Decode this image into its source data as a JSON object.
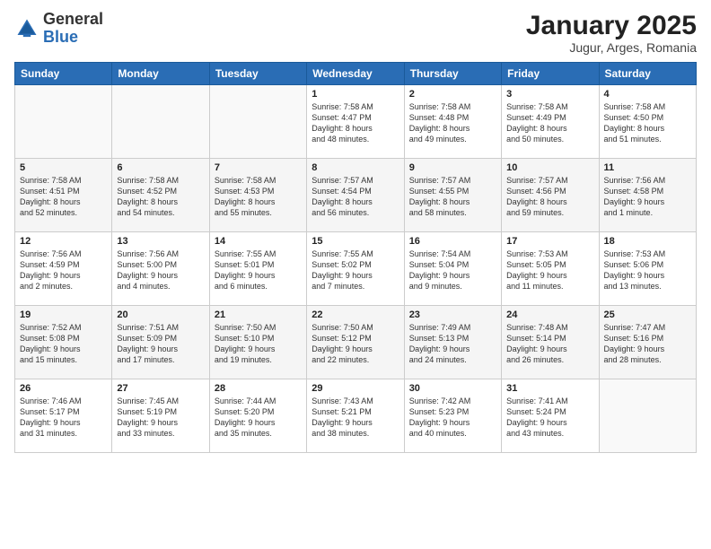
{
  "header": {
    "logo_general": "General",
    "logo_blue": "Blue",
    "month_title": "January 2025",
    "location": "Jugur, Arges, Romania"
  },
  "days_of_week": [
    "Sunday",
    "Monday",
    "Tuesday",
    "Wednesday",
    "Thursday",
    "Friday",
    "Saturday"
  ],
  "weeks": [
    [
      {
        "num": "",
        "info": ""
      },
      {
        "num": "",
        "info": ""
      },
      {
        "num": "",
        "info": ""
      },
      {
        "num": "1",
        "info": "Sunrise: 7:58 AM\nSunset: 4:47 PM\nDaylight: 8 hours\nand 48 minutes."
      },
      {
        "num": "2",
        "info": "Sunrise: 7:58 AM\nSunset: 4:48 PM\nDaylight: 8 hours\nand 49 minutes."
      },
      {
        "num": "3",
        "info": "Sunrise: 7:58 AM\nSunset: 4:49 PM\nDaylight: 8 hours\nand 50 minutes."
      },
      {
        "num": "4",
        "info": "Sunrise: 7:58 AM\nSunset: 4:50 PM\nDaylight: 8 hours\nand 51 minutes."
      }
    ],
    [
      {
        "num": "5",
        "info": "Sunrise: 7:58 AM\nSunset: 4:51 PM\nDaylight: 8 hours\nand 52 minutes."
      },
      {
        "num": "6",
        "info": "Sunrise: 7:58 AM\nSunset: 4:52 PM\nDaylight: 8 hours\nand 54 minutes."
      },
      {
        "num": "7",
        "info": "Sunrise: 7:58 AM\nSunset: 4:53 PM\nDaylight: 8 hours\nand 55 minutes."
      },
      {
        "num": "8",
        "info": "Sunrise: 7:57 AM\nSunset: 4:54 PM\nDaylight: 8 hours\nand 56 minutes."
      },
      {
        "num": "9",
        "info": "Sunrise: 7:57 AM\nSunset: 4:55 PM\nDaylight: 8 hours\nand 58 minutes."
      },
      {
        "num": "10",
        "info": "Sunrise: 7:57 AM\nSunset: 4:56 PM\nDaylight: 8 hours\nand 59 minutes."
      },
      {
        "num": "11",
        "info": "Sunrise: 7:56 AM\nSunset: 4:58 PM\nDaylight: 9 hours\nand 1 minute."
      }
    ],
    [
      {
        "num": "12",
        "info": "Sunrise: 7:56 AM\nSunset: 4:59 PM\nDaylight: 9 hours\nand 2 minutes."
      },
      {
        "num": "13",
        "info": "Sunrise: 7:56 AM\nSunset: 5:00 PM\nDaylight: 9 hours\nand 4 minutes."
      },
      {
        "num": "14",
        "info": "Sunrise: 7:55 AM\nSunset: 5:01 PM\nDaylight: 9 hours\nand 6 minutes."
      },
      {
        "num": "15",
        "info": "Sunrise: 7:55 AM\nSunset: 5:02 PM\nDaylight: 9 hours\nand 7 minutes."
      },
      {
        "num": "16",
        "info": "Sunrise: 7:54 AM\nSunset: 5:04 PM\nDaylight: 9 hours\nand 9 minutes."
      },
      {
        "num": "17",
        "info": "Sunrise: 7:53 AM\nSunset: 5:05 PM\nDaylight: 9 hours\nand 11 minutes."
      },
      {
        "num": "18",
        "info": "Sunrise: 7:53 AM\nSunset: 5:06 PM\nDaylight: 9 hours\nand 13 minutes."
      }
    ],
    [
      {
        "num": "19",
        "info": "Sunrise: 7:52 AM\nSunset: 5:08 PM\nDaylight: 9 hours\nand 15 minutes."
      },
      {
        "num": "20",
        "info": "Sunrise: 7:51 AM\nSunset: 5:09 PM\nDaylight: 9 hours\nand 17 minutes."
      },
      {
        "num": "21",
        "info": "Sunrise: 7:50 AM\nSunset: 5:10 PM\nDaylight: 9 hours\nand 19 minutes."
      },
      {
        "num": "22",
        "info": "Sunrise: 7:50 AM\nSunset: 5:12 PM\nDaylight: 9 hours\nand 22 minutes."
      },
      {
        "num": "23",
        "info": "Sunrise: 7:49 AM\nSunset: 5:13 PM\nDaylight: 9 hours\nand 24 minutes."
      },
      {
        "num": "24",
        "info": "Sunrise: 7:48 AM\nSunset: 5:14 PM\nDaylight: 9 hours\nand 26 minutes."
      },
      {
        "num": "25",
        "info": "Sunrise: 7:47 AM\nSunset: 5:16 PM\nDaylight: 9 hours\nand 28 minutes."
      }
    ],
    [
      {
        "num": "26",
        "info": "Sunrise: 7:46 AM\nSunset: 5:17 PM\nDaylight: 9 hours\nand 31 minutes."
      },
      {
        "num": "27",
        "info": "Sunrise: 7:45 AM\nSunset: 5:19 PM\nDaylight: 9 hours\nand 33 minutes."
      },
      {
        "num": "28",
        "info": "Sunrise: 7:44 AM\nSunset: 5:20 PM\nDaylight: 9 hours\nand 35 minutes."
      },
      {
        "num": "29",
        "info": "Sunrise: 7:43 AM\nSunset: 5:21 PM\nDaylight: 9 hours\nand 38 minutes."
      },
      {
        "num": "30",
        "info": "Sunrise: 7:42 AM\nSunset: 5:23 PM\nDaylight: 9 hours\nand 40 minutes."
      },
      {
        "num": "31",
        "info": "Sunrise: 7:41 AM\nSunset: 5:24 PM\nDaylight: 9 hours\nand 43 minutes."
      },
      {
        "num": "",
        "info": ""
      }
    ]
  ]
}
